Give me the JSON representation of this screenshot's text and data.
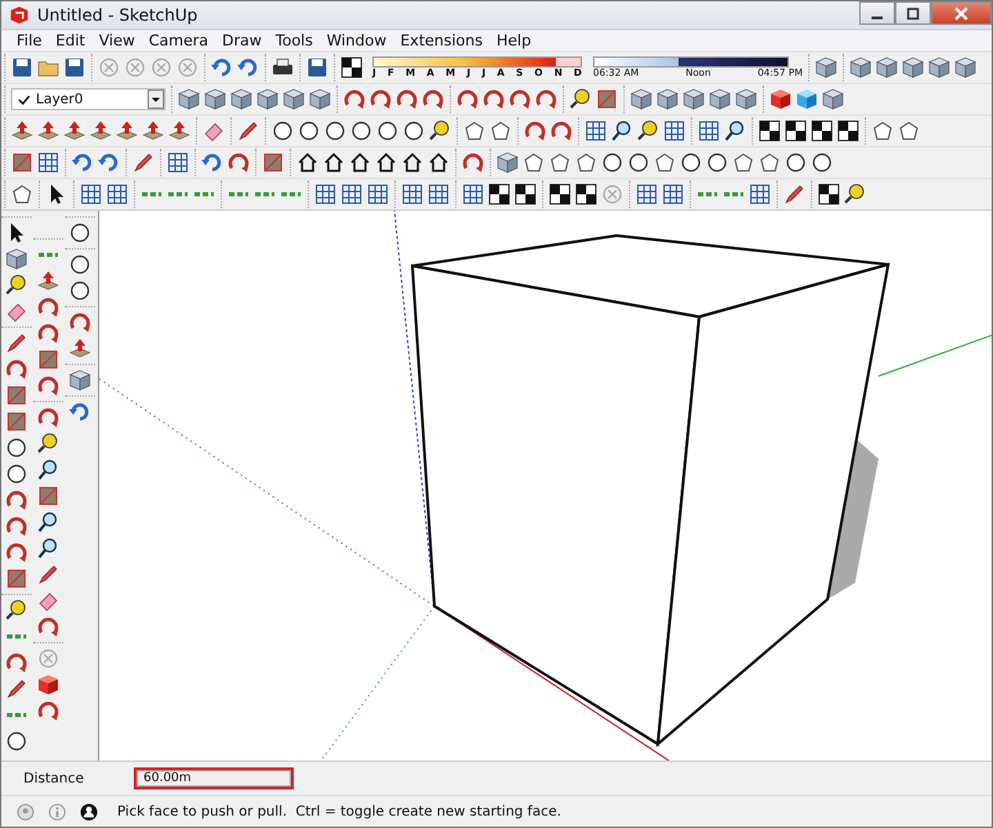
{
  "window": {
    "title": "Untitled - SketchUp"
  },
  "menu": [
    "File",
    "Edit",
    "View",
    "Camera",
    "Draw",
    "Tools",
    "Window",
    "Extensions",
    "Help"
  ],
  "shadow_settings": {
    "date_slider": {
      "level": 0.88
    },
    "time_slider": {
      "level": 0.44
    },
    "months": [
      "J",
      "F",
      "M",
      "A",
      "M",
      "J",
      "J",
      "A",
      "S",
      "O",
      "N",
      "D"
    ],
    "start_time": "06:32 AM",
    "noon_label": "Noon",
    "end_time": "04:57 PM"
  },
  "layer_selector": {
    "value": "Layer0"
  },
  "measurements": {
    "label": "Distance",
    "value": "60.00m"
  },
  "status_bar": {
    "message": "Pick face to push or pull.  Ctrl = toggle create new starting face."
  }
}
